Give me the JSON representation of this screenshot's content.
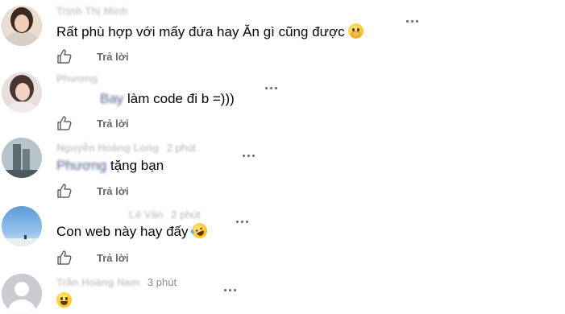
{
  "comments": [
    {
      "author_blurred": "Trịnh Thị Minh",
      "time": "",
      "text_prefix_blurred": "",
      "text": "Rất phù hợp với mấy đứa hay Ăn gì cũng được",
      "emoji": "shushing-face-icon",
      "reply_label": "Trả lời"
    },
    {
      "author_blurred": "Phương",
      "time": "",
      "text_prefix_blurred": "Bay",
      "text": "làm code đi b =)))",
      "emoji": "",
      "reply_label": "Trả lời"
    },
    {
      "author_blurred": "Nguyễn Hoàng Long",
      "time": "2 phút",
      "text_prefix_blurred": "Phương",
      "text": "tặng bạn",
      "emoji": "",
      "reply_label": "Trả lời"
    },
    {
      "author_blurred": "Lê Văn",
      "time": "2 phút",
      "text_prefix_blurred": "",
      "text": "Con web này hay đấy",
      "emoji": "rolling-on-floor-laughing-icon",
      "reply_label": "Trả lời"
    },
    {
      "author_blurred": "Trần Hoàng Nam",
      "time": "3 phút",
      "text_prefix_blurred": "",
      "text": "",
      "emoji": "grinning-face-icon",
      "reply_label": ""
    }
  ],
  "colors": {
    "secondary_text": "#65676b",
    "primary_text": "#050505",
    "background": "#ffffff"
  }
}
